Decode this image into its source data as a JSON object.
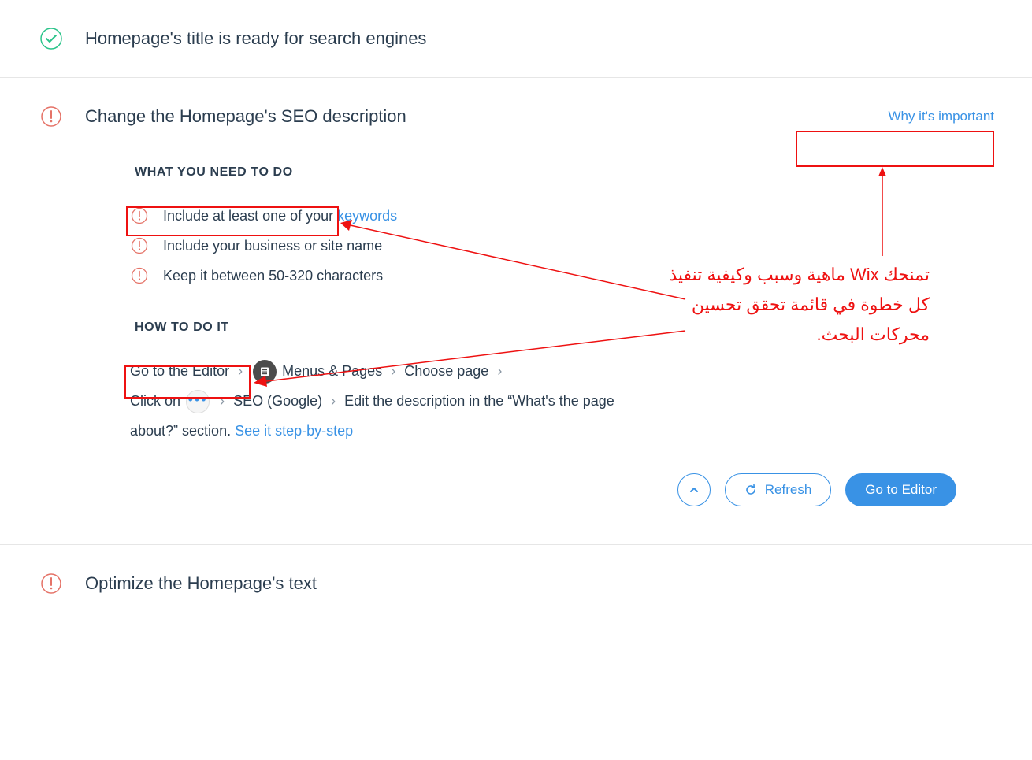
{
  "row1": {
    "title": "Homepage's title is ready for search engines",
    "status": "ok"
  },
  "row2": {
    "title": "Change the Homepage's SEO description",
    "why_label": "Why it's important",
    "what_h": "WHAT YOU NEED TO DO",
    "items": [
      {
        "pre": "Include at least one of your ",
        "link": "keywords"
      },
      {
        "pre": "Include your business or site name",
        "link": ""
      },
      {
        "pre": "Keep it between 50-320 characters",
        "link": ""
      }
    ],
    "how_h": "HOW TO DO IT",
    "how": {
      "a": "Go to the Editor",
      "b": "Menus & Pages",
      "c": "Choose page",
      "d": "Click on",
      "e": "SEO (Google)",
      "f": "Edit the description in the “What's the page about?” section. ",
      "link": "See it step-by-step"
    },
    "btn_refresh": "Refresh",
    "btn_editor": "Go to Editor"
  },
  "row3": {
    "title": "Optimize the Homepage's text"
  },
  "annot": {
    "text": "تمنحك Wix ماهية وسبب وكيفية تنفيذ كل خطوة في قائمة تحقق تحسين محركات البحث."
  }
}
